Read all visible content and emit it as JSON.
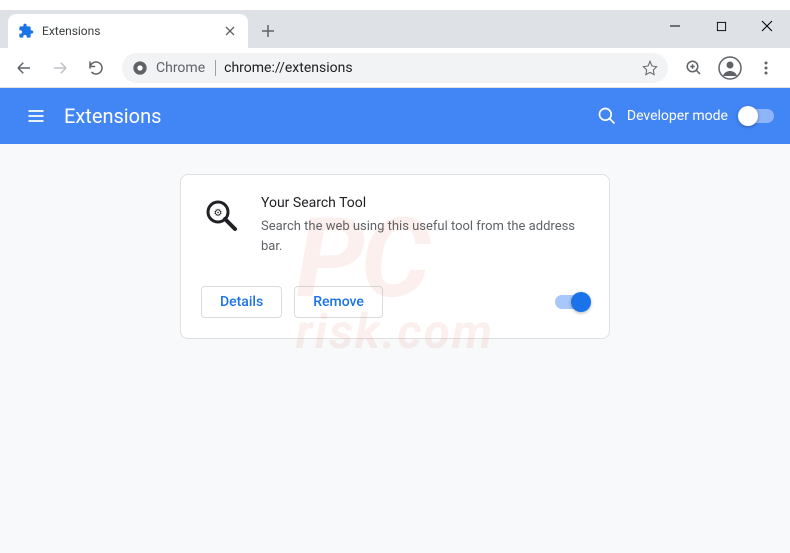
{
  "window": {
    "tab_title": "Extensions"
  },
  "toolbar": {
    "chrome_label": "Chrome",
    "url": "chrome://extensions"
  },
  "header": {
    "title": "Extensions",
    "dev_mode_label": "Developer mode",
    "dev_mode_on": false
  },
  "extension": {
    "name": "Your Search Tool",
    "description": "Search the web using this useful tool from the address bar.",
    "details_label": "Details",
    "remove_label": "Remove",
    "enabled": true
  },
  "watermark": {
    "main": "PC",
    "sub": "risk.com"
  }
}
